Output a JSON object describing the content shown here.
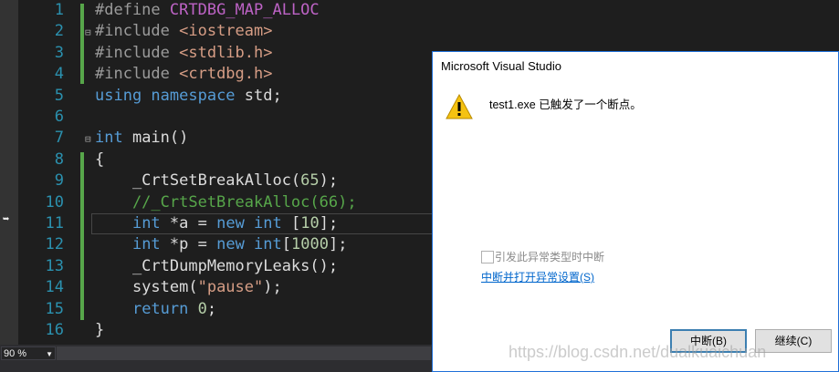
{
  "editor": {
    "lines": [
      {
        "num": "1",
        "parts": [
          {
            "t": "#define ",
            "c": "pp"
          },
          {
            "t": "CRTDBG_MAP_ALLOC",
            "c": "mac"
          }
        ]
      },
      {
        "num": "2",
        "parts": [
          {
            "t": "#include ",
            "c": "pp"
          },
          {
            "t": "<iostream>",
            "c": "str"
          }
        ]
      },
      {
        "num": "3",
        "parts": [
          {
            "t": "#include ",
            "c": "pp"
          },
          {
            "t": "<stdlib.h>",
            "c": "str"
          }
        ]
      },
      {
        "num": "4",
        "parts": [
          {
            "t": "#include ",
            "c": "pp"
          },
          {
            "t": "<crtdbg.h>",
            "c": "str"
          }
        ]
      },
      {
        "num": "5",
        "parts": [
          {
            "t": "using ",
            "c": "kw"
          },
          {
            "t": "namespace ",
            "c": "kw"
          },
          {
            "t": "std;",
            "c": ""
          }
        ]
      },
      {
        "num": "6",
        "parts": []
      },
      {
        "num": "7",
        "parts": [
          {
            "t": "int ",
            "c": "kw"
          },
          {
            "t": "main()",
            "c": ""
          }
        ]
      },
      {
        "num": "8",
        "parts": [
          {
            "t": "{",
            "c": ""
          }
        ]
      },
      {
        "num": "9",
        "parts": [
          {
            "t": "    _CrtSetBreakAlloc(",
            "c": ""
          },
          {
            "t": "65",
            "c": "num"
          },
          {
            "t": ");",
            "c": ""
          }
        ]
      },
      {
        "num": "10",
        "parts": [
          {
            "t": "    //_CrtSetBreakAlloc(66);",
            "c": "cmt"
          }
        ]
      },
      {
        "num": "11",
        "parts": [
          {
            "t": "    ",
            "c": ""
          },
          {
            "t": "int",
            "c": "kw"
          },
          {
            "t": " *a = ",
            "c": ""
          },
          {
            "t": "new ",
            "c": "kw"
          },
          {
            "t": "int",
            "c": "kw"
          },
          {
            "t": " [",
            "c": ""
          },
          {
            "t": "10",
            "c": "num"
          },
          {
            "t": "];",
            "c": ""
          }
        ]
      },
      {
        "num": "12",
        "parts": [
          {
            "t": "    ",
            "c": ""
          },
          {
            "t": "int",
            "c": "kw"
          },
          {
            "t": " *p = ",
            "c": ""
          },
          {
            "t": "new ",
            "c": "kw"
          },
          {
            "t": "int",
            "c": "kw"
          },
          {
            "t": "[",
            "c": ""
          },
          {
            "t": "1000",
            "c": "num"
          },
          {
            "t": "];",
            "c": ""
          }
        ]
      },
      {
        "num": "13",
        "parts": [
          {
            "t": "    _CrtDumpMemoryLeaks();",
            "c": ""
          }
        ]
      },
      {
        "num": "14",
        "parts": [
          {
            "t": "    system(",
            "c": ""
          },
          {
            "t": "\"pause\"",
            "c": "str"
          },
          {
            "t": ");",
            "c": ""
          }
        ]
      },
      {
        "num": "15",
        "parts": [
          {
            "t": "    ",
            "c": ""
          },
          {
            "t": "return ",
            "c": "kw"
          },
          {
            "t": "0",
            "c": "num"
          },
          {
            "t": ";",
            "c": ""
          }
        ]
      },
      {
        "num": "16",
        "parts": [
          {
            "t": "}",
            "c": ""
          }
        ]
      }
    ],
    "zoom": "90 %"
  },
  "dialog": {
    "title": "Microsoft Visual Studio",
    "message": "test1.exe 已触发了一个断点。",
    "checkbox_label": "引发此异常类型时中断",
    "link": "中断并打开异常设置(S)",
    "break_button": "中断(B)",
    "continue_button": "继续(C)"
  },
  "watermark": "https://blog.csdn.net/dualkuaichuan",
  "colors": {
    "keyword": "#569cd6",
    "string": "#d69d85",
    "macro": "#bd63c5",
    "comment": "#57a64a",
    "number": "#b5cea8",
    "line_number": "#2b91af"
  }
}
